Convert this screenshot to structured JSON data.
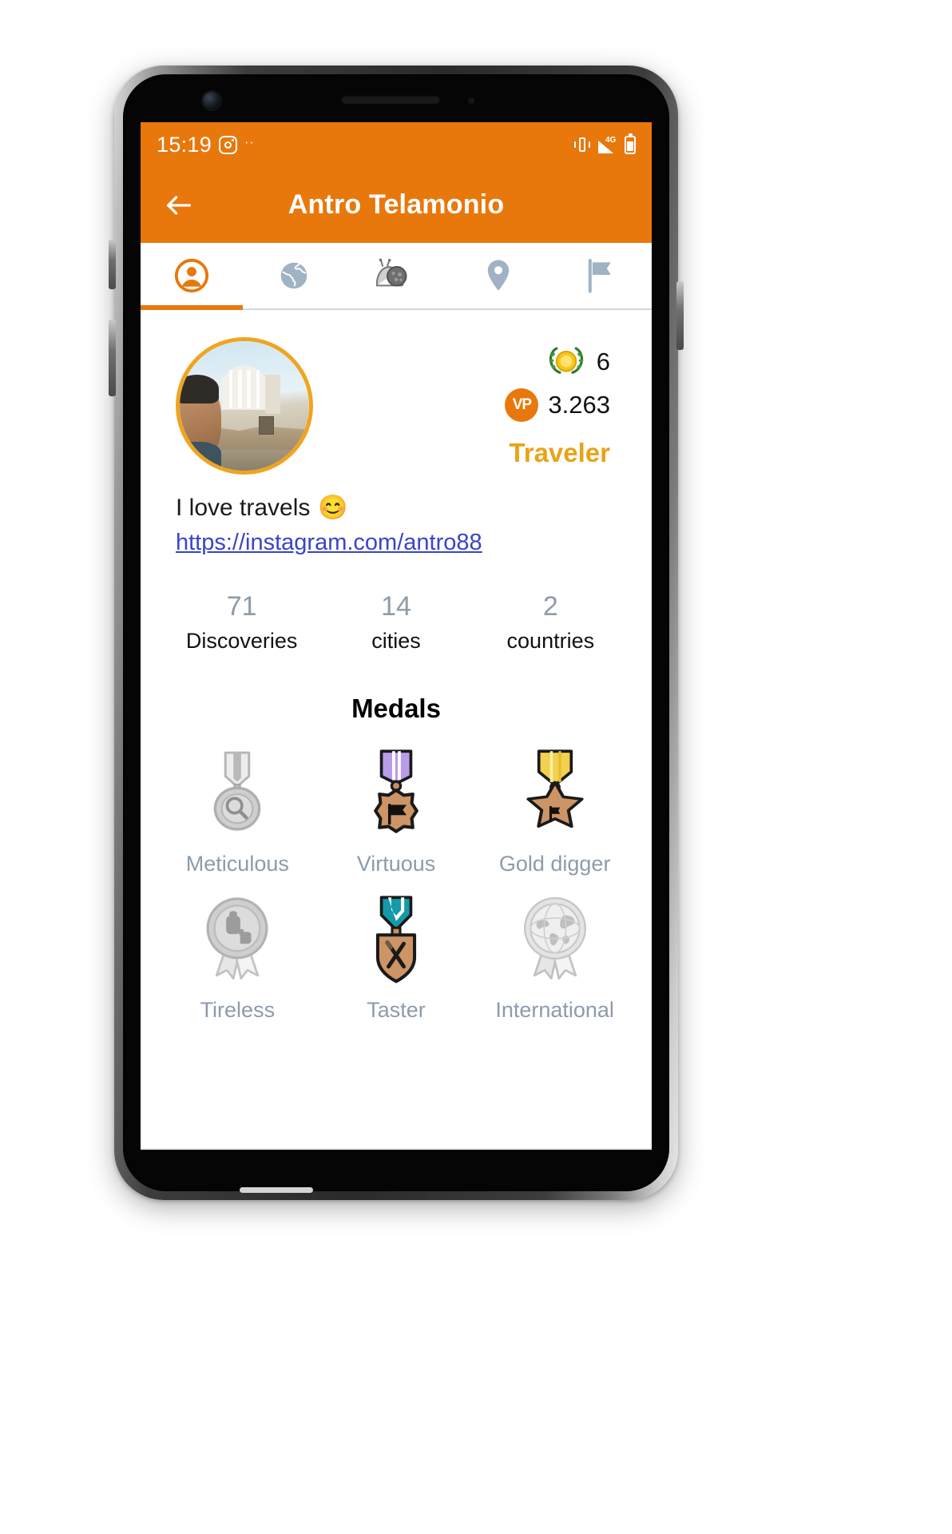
{
  "status_bar": {
    "time": "15:19",
    "instagram_icon": "instagram-icon",
    "overflow_dots": "··",
    "vibrate_icon": "vibrate-icon",
    "signal_label": "4G",
    "battery_icon": "battery-icon"
  },
  "app_bar": {
    "back_icon": "back-arrow-icon",
    "title": "Antro Telamonio"
  },
  "tabs": [
    {
      "name": "profile",
      "icon": "person-circle-icon",
      "active": true
    },
    {
      "name": "world",
      "icon": "globe-icon",
      "active": false
    },
    {
      "name": "snail",
      "icon": "snail-icon",
      "active": false
    },
    {
      "name": "places",
      "icon": "location-pin-icon",
      "active": false
    },
    {
      "name": "flags",
      "icon": "flag-icon",
      "active": false
    }
  ],
  "profile": {
    "avatar_alt": "user-selfie-in-rome",
    "laurel_icon": "laurel-wreath-icon",
    "laurel_value": "6",
    "vp_icon": "vp-icon",
    "vp_label": "VP",
    "vp_value": "3.263",
    "rank": "Traveler",
    "bio_text": "I love travels",
    "bio_emoji": "😊",
    "link": "https://instagram.com/antro88"
  },
  "stats": [
    {
      "value": "71",
      "label": "Discoveries"
    },
    {
      "value": "14",
      "label": "cities"
    },
    {
      "value": "2",
      "label": "countries"
    }
  ],
  "medals_section": {
    "title": "Medals"
  },
  "medals": [
    {
      "label": "Meticulous",
      "icon": "medal-magnifier-icon",
      "earned": false
    },
    {
      "label": "Virtuous",
      "icon": "medal-flag-star-icon",
      "earned": true
    },
    {
      "label": "Gold digger",
      "icon": "medal-gold-star-icon",
      "earned": true
    },
    {
      "label": "Tireless",
      "icon": "rosette-backpack-icon",
      "earned": false
    },
    {
      "label": "Taster",
      "icon": "medal-cutlery-icon",
      "earned": true
    },
    {
      "label": "International",
      "icon": "rosette-globe-icon",
      "earned": false
    }
  ],
  "nav_bar": {
    "back_icon": "nav-back-triangle-icon",
    "home_icon": "nav-home-circle-icon",
    "recents_icon": "nav-recents-square-icon",
    "dot_icon": "nav-dot-icon"
  },
  "colors": {
    "brand_orange": "#E8780C",
    "rank_gold": "#E8A317",
    "muted_blue_grey": "#8d9bab",
    "link_blue": "#3b44c7"
  }
}
